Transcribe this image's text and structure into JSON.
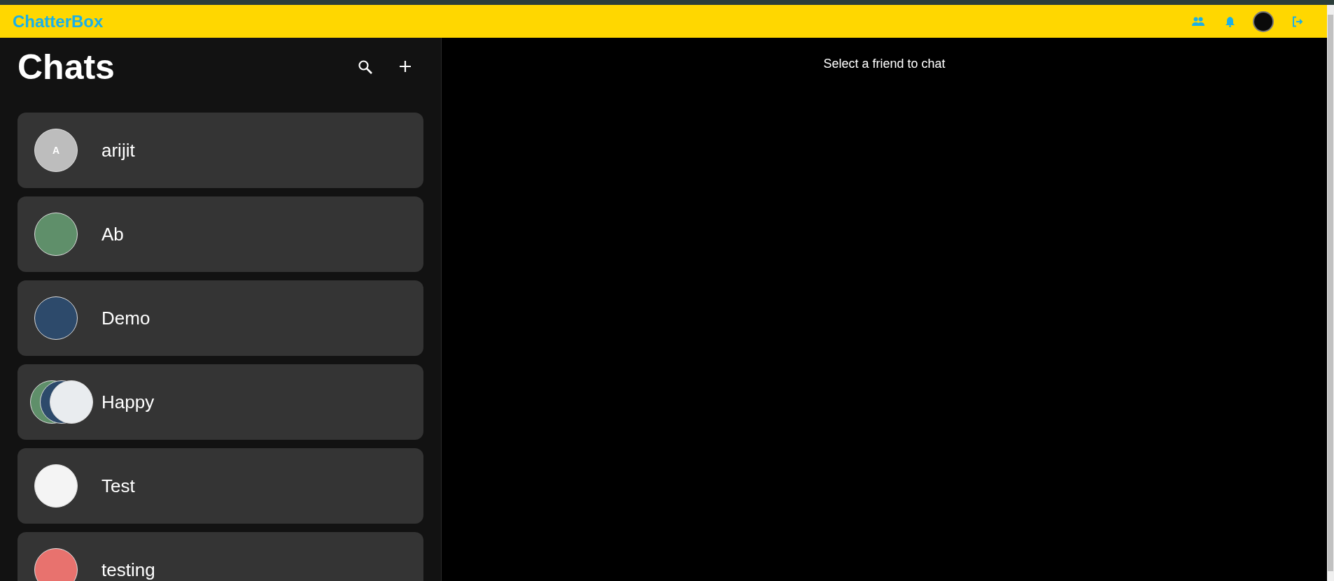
{
  "app_bar": {
    "brand": "ChatterBox",
    "current_user_avatar": {
      "kind": "photo"
    }
  },
  "sidebar": {
    "title": "Chats",
    "chats": [
      {
        "name": "arijit",
        "avatar": {
          "kind": "letter",
          "text": "A"
        }
      },
      {
        "name": "Ab",
        "avatar": {
          "kind": "photo"
        }
      },
      {
        "name": "Demo",
        "avatar": {
          "kind": "photo"
        }
      },
      {
        "name": "Happy",
        "avatar": {
          "kind": "group",
          "members": [
            {
              "kind": "photo"
            },
            {
              "kind": "photo"
            },
            {
              "kind": "photo"
            }
          ]
        }
      },
      {
        "name": "Test",
        "avatar": {
          "kind": "photo"
        }
      },
      {
        "name": "testing",
        "avatar": {
          "kind": "photo"
        }
      }
    ]
  },
  "main": {
    "empty_message": "Select a friend to chat"
  }
}
